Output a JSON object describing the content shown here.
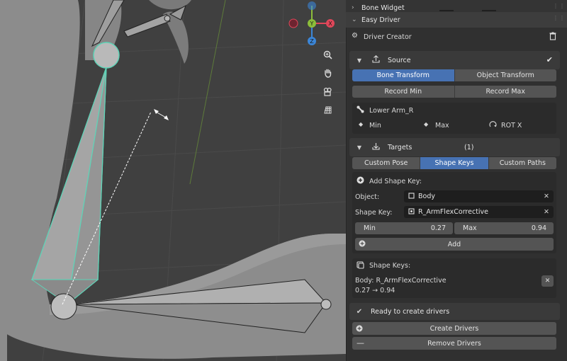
{
  "panel": {
    "bone_widget_label": "Bone Widget",
    "easy_driver_label": "Easy Driver",
    "driver_creator_label": "Driver Creator",
    "source": {
      "label": "Source",
      "modes": [
        "Bone Transform",
        "Object Transform"
      ],
      "active_mode": "Bone Transform",
      "record_min": "Record Min",
      "record_max": "Record Max",
      "bone_name": "Lower Arm_R",
      "min_label": "Min",
      "max_label": "Max",
      "channel": "ROT X"
    },
    "targets": {
      "label": "Targets",
      "count": "(1)",
      "tabs": [
        "Custom Pose",
        "Shape Keys",
        "Custom Paths"
      ],
      "active_tab": "Shape Keys",
      "add_shape_key_label": "Add Shape Key:",
      "object_label": "Object:",
      "object_value": "Body",
      "shape_key_label": "Shape Key:",
      "shape_key_value": "R_ArmFlexCorrective",
      "min_label": "Min",
      "min_value": "0.27",
      "max_label": "Max",
      "max_value": "0.94",
      "add_button": "Add",
      "list_label": "Shape Keys:",
      "entry_name": "Body: R_ArmFlexCorrective",
      "entry_range": "0.27 → 0.94"
    },
    "status": "Ready to create drivers",
    "create_drivers": "Create Drivers",
    "remove_drivers": "Remove Drivers"
  },
  "gizmo": {
    "axes": [
      "X",
      "Y",
      "Z"
    ],
    "colors": {
      "x": "#e0475a",
      "y": "#8cbe3a",
      "z": "#3b86d8",
      "selection": "#5fd3b7"
    }
  },
  "icons": [
    "zoom-icon",
    "hand-icon",
    "camera-icon",
    "grid-icon",
    "trash-icon",
    "checkmark-icon",
    "upload-icon",
    "download-icon",
    "bone-icon",
    "plus-icon",
    "minus-icon",
    "close-icon"
  ]
}
